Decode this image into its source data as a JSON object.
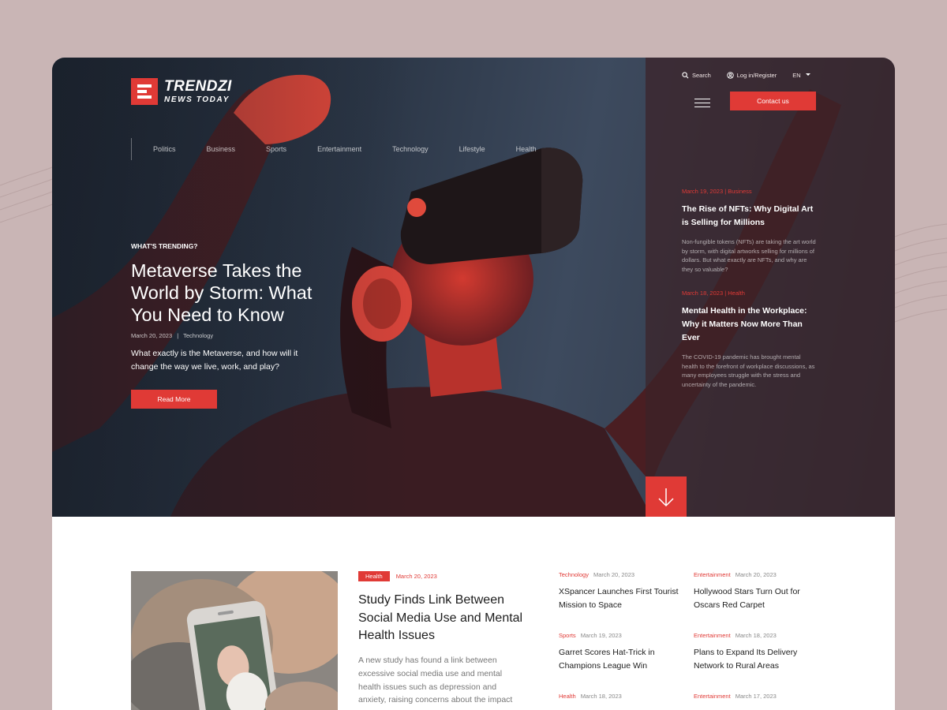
{
  "brand": {
    "name": "TRENDZI",
    "tagline": "NEWS TODAY",
    "accent": "#e03a36"
  },
  "header": {
    "search_label": "Search",
    "login_label": "Log in/Register",
    "language": "EN",
    "contact_label": "Contact us"
  },
  "nav": {
    "items": [
      "Politics",
      "Business",
      "Sports",
      "Entertainment",
      "Technology",
      "Lifestyle",
      "Health"
    ]
  },
  "hero": {
    "kicker": "WHAT'S TRENDING?",
    "title": "Metaverse Takes the World by Storm: What You Need to Know",
    "date": "March 20, 2023",
    "category": "Technology",
    "excerpt": "What exactly is the Metaverse, and how will it change the way we live, work, and play?",
    "cta": "Read More"
  },
  "side_articles": [
    {
      "meta": "March 19, 2023  |  Business",
      "title": "The Rise of NFTs: Why Digital Art is Selling for Millions",
      "excerpt": "Non-fungible tokens (NFTs) are taking the art world by storm, with digital artworks selling for millions of dollars. But what exactly are NFTs, and why are they so valuable?"
    },
    {
      "meta": "March 18, 2023  |  Health",
      "title": "Mental Health in the Workplace: Why it Matters Now More Than Ever",
      "excerpt": "The COVID-19 pandemic has brought mental health to the forefront of workplace discussions, as many employees struggle with the stress and uncertainty of the pandemic."
    }
  ],
  "featured": {
    "tag": "Health",
    "date": "March 20, 2023",
    "title": "Study Finds Link Between Social Media Use and Mental Health Issues",
    "excerpt": "A new study has found a link between excessive social media use and mental health issues such as depression and anxiety, raising concerns about the impact"
  },
  "news_grid": [
    {
      "category": "Technology",
      "date": "March 20, 2023",
      "title": "XSpancer Launches First Tourist Mission to Space"
    },
    {
      "category": "Entertainment",
      "date": "March 20, 2023",
      "title": "Hollywood Stars Turn Out for Oscars Red Carpet"
    },
    {
      "category": "Sports",
      "date": "March 19, 2023",
      "title": "Garret Scores Hat-Trick in Champions League Win"
    },
    {
      "category": "Entertainment",
      "date": "March 18, 2023",
      "title": "Plans to Expand Its Delivery Network to Rural Areas"
    },
    {
      "category": "Health",
      "date": "March 18, 2023",
      "title": ""
    },
    {
      "category": "Entertainment",
      "date": "March 17, 2023",
      "title": ""
    }
  ]
}
